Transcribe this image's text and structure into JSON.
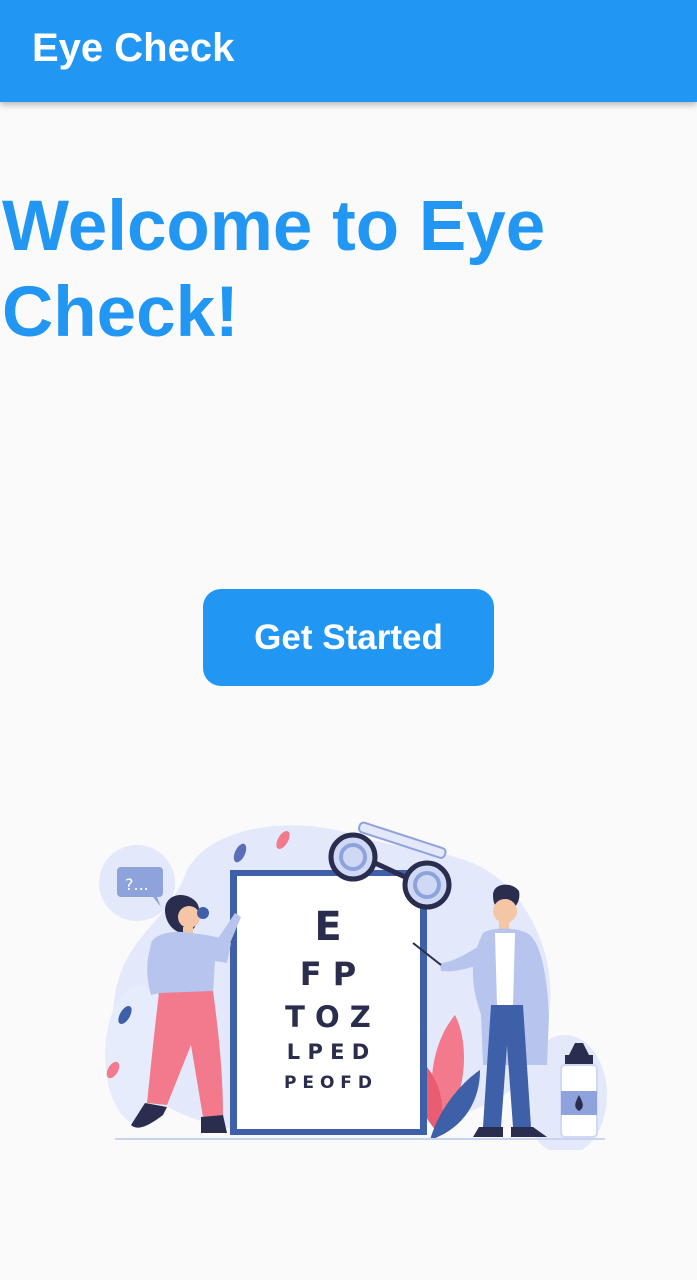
{
  "app_bar": {
    "title": "Eye Check"
  },
  "main": {
    "headline": "Welcome to Eye Check!",
    "cta_label": "Get Started"
  },
  "illustration": {
    "speech_bubble_text": "?...",
    "eye_chart_rows": [
      "E",
      "F P",
      "T O Z",
      "L P E D",
      "P E O F D"
    ]
  },
  "colors": {
    "primary": "#2196f3",
    "background": "#fafafa",
    "on_primary": "#ffffff"
  }
}
